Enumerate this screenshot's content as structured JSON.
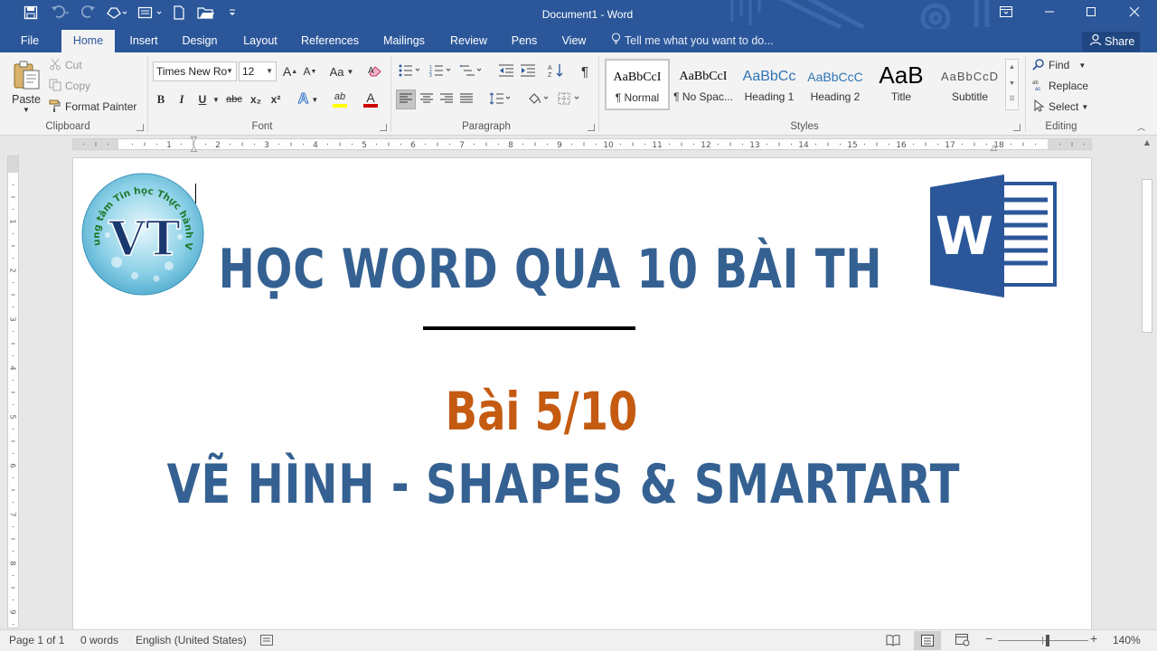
{
  "window": {
    "title": "Document1 - Word",
    "controls": {
      "restore_ribbon": "⧉",
      "minimize": "─",
      "maximize": "□",
      "close": "✕"
    }
  },
  "quick_access": [
    {
      "name": "save",
      "icon": "save-icon"
    },
    {
      "name": "undo",
      "icon": "undo-icon"
    },
    {
      "name": "redo",
      "icon": "redo-icon"
    },
    {
      "name": "touch-mode",
      "icon": "touch-mode-icon"
    },
    {
      "name": "print-layout",
      "icon": "print-layout-icon"
    },
    {
      "name": "new",
      "icon": "new-document-icon"
    },
    {
      "name": "open",
      "icon": "open-folder-icon"
    },
    {
      "name": "customize",
      "icon": "customize-qat-icon"
    }
  ],
  "tabs": [
    "File",
    "Home",
    "Insert",
    "Design",
    "Layout",
    "References",
    "Mailings",
    "Review",
    "Pens",
    "View"
  ],
  "active_tab": "Home",
  "tell_me": "Tell me what you want to do...",
  "share_label": "Share",
  "clipboard": {
    "paste": "Paste",
    "cut": "Cut",
    "copy": "Copy",
    "format_painter": "Format Painter",
    "group": "Clipboard"
  },
  "font": {
    "name": "Times New Ro",
    "size": "12",
    "group": "Font",
    "change_case": "Aa",
    "bold": "B",
    "italic": "I",
    "underline": "U",
    "strike": "abc",
    "subscript": "x₂",
    "superscript": "x²",
    "effects": "A",
    "highlight": "ab",
    "color": "A",
    "grow": "A",
    "shrink": "A",
    "highlight_color": "#ffff00",
    "font_color": "#d00000"
  },
  "paragraph": {
    "group": "Paragraph",
    "show_marks": "¶"
  },
  "styles": {
    "group": "Styles",
    "items": [
      {
        "preview": "AaBbCcI",
        "name": "¶ Normal"
      },
      {
        "preview": "AaBbCcI",
        "name": "¶ No Spac..."
      },
      {
        "preview": "AaBbCc",
        "name": "Heading 1"
      },
      {
        "preview": "AaBbCcC",
        "name": "Heading 2"
      },
      {
        "preview": "AaB",
        "name": "Title"
      },
      {
        "preview": "AaBbCcD",
        "name": "Subtitle"
      }
    ]
  },
  "editing": {
    "find": "Find",
    "replace": "Replace",
    "select": "Select",
    "group": "Editing"
  },
  "ruler": {
    "marks": [
      "2",
      "1",
      "1",
      "2",
      "3",
      "4",
      "5",
      "6",
      "7",
      "8",
      "9",
      "10",
      "11",
      "12",
      "13",
      "14",
      "15",
      "16",
      "17",
      "18"
    ],
    "vmarks": [
      "1",
      "2",
      "3",
      "4",
      "5",
      "6",
      "7",
      "8",
      "9"
    ]
  },
  "document": {
    "heading": "HỌC WORD QUA 10 BÀI TH",
    "lesson": "Bài 5/10",
    "topic": "VẼ HÌNH - SHAPES & SMARTART",
    "logo_text": "Trung tâm Tin học Thực hành VT",
    "logo_monogram": "VT",
    "word_logo_letter": "W",
    "colors": {
      "heading": "#356192",
      "lesson": "#c55a11",
      "rule": "#000000",
      "word_blue": "#2b579a"
    }
  },
  "status": {
    "page": "Page 1 of 1",
    "words": "0 words",
    "language": "English (United States)",
    "zoom": "140%"
  },
  "colors": {
    "accent": "#2b579a",
    "ribbon_bg": "#f3f3f3",
    "canvas_bg": "#e7e7e7"
  }
}
